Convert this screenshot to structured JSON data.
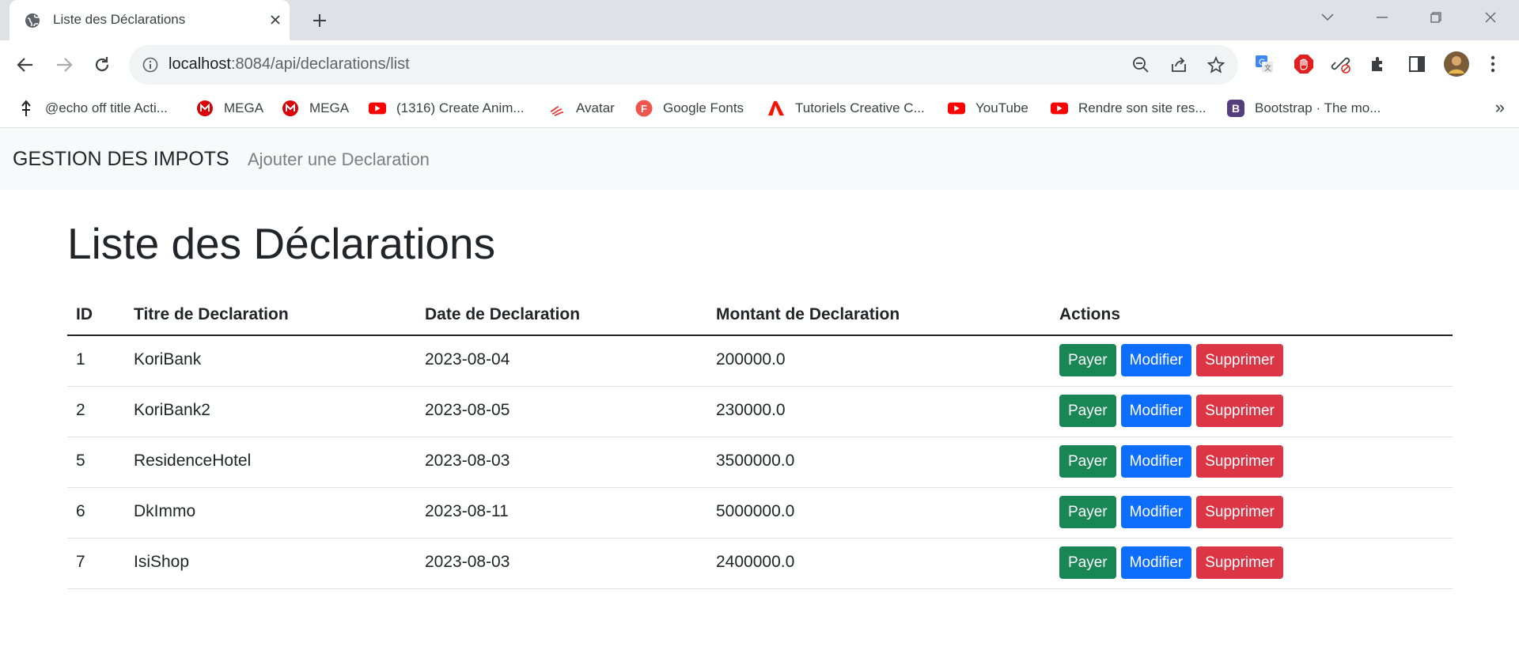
{
  "browser": {
    "tab_title": "Liste des Déclarations",
    "url_host": "localhost",
    "url_path": ":8084/api/declarations/list",
    "bookmarks": [
      {
        "label": "@echo off title Acti...",
        "icon": "pin-icon"
      },
      {
        "label": "MEGA",
        "icon": "mega-icon"
      },
      {
        "label": "MEGA",
        "icon": "mega-icon"
      },
      {
        "label": "(1316) Create Anim...",
        "icon": "youtube-icon"
      },
      {
        "label": "Avatar",
        "icon": "avatar-icon"
      },
      {
        "label": "Google Fonts",
        "icon": "google-fonts-icon"
      },
      {
        "label": "Tutoriels Creative C...",
        "icon": "adobe-icon"
      },
      {
        "label": "YouTube",
        "icon": "youtube-icon"
      },
      {
        "label": "Rendre son site res...",
        "icon": "youtube-icon"
      },
      {
        "label": "Bootstrap · The mo...",
        "icon": "bootstrap-icon"
      }
    ],
    "more_bookmarks": "»"
  },
  "app": {
    "brand": "GESTION DES IMPOTS",
    "nav_link": "Ajouter une Declaration"
  },
  "page": {
    "title": "Liste des Déclarations"
  },
  "table": {
    "headers": {
      "id": "ID",
      "title": "Titre de Declaration",
      "date": "Date de Declaration",
      "amount": "Montant de Declaration",
      "actions": "Actions"
    },
    "rows": [
      {
        "id": "1",
        "title": "KoriBank",
        "date": "2023-08-04",
        "amount": "200000.0"
      },
      {
        "id": "2",
        "title": "KoriBank2",
        "date": "2023-08-05",
        "amount": "230000.0"
      },
      {
        "id": "5",
        "title": "ResidenceHotel",
        "date": "2023-08-03",
        "amount": "3500000.0"
      },
      {
        "id": "6",
        "title": "DkImmo",
        "date": "2023-08-11",
        "amount": "5000000.0"
      },
      {
        "id": "7",
        "title": "IsiShop",
        "date": "2023-08-03",
        "amount": "2400000.0"
      }
    ],
    "buttons": {
      "pay": "Payer",
      "edit": "Modifier",
      "delete": "Supprimer"
    }
  },
  "colors": {
    "success": "#198754",
    "primary": "#0d6efd",
    "danger": "#dc3545",
    "navbar_bg": "#f8f9fa"
  }
}
